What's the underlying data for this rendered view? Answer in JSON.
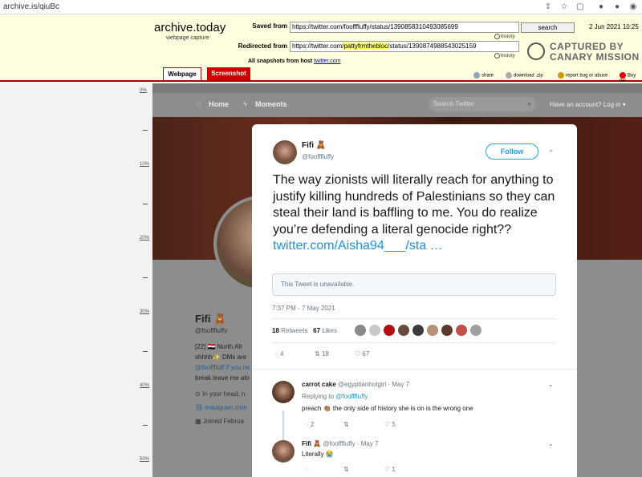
{
  "browser": {
    "url": "archive.is/qiuBc"
  },
  "archive": {
    "title": "archive.today",
    "subtitle": "webpage capture",
    "saved_from_label": "Saved from",
    "saved_from_url": "https://twitter.com/foofffluffy/status/1390858310493085699",
    "redirected_from_label": "Redirected from",
    "redirected_prefix": "https://twitter.com/",
    "redirected_highlight": "pattyfrmthebloc",
    "redirected_suffix": "/status/1390874988543025159",
    "history_label": "history",
    "search_label": "search",
    "date": "2 Jun 2021 10:25",
    "snapshots_label": "All snapshots  from host",
    "snapshots_host": "twitter.com",
    "tab_webpage": "Webpage",
    "tab_screenshot": "Screenshot",
    "link_share": "share",
    "link_download": "download .zip",
    "link_report": "report bug or abuse",
    "link_buy": "Buy me",
    "canary_line1": "CAPTURED BY",
    "canary_line2": "CANARY MISSION"
  },
  "ruler": [
    "0%",
    "10%",
    "20%",
    "30%",
    "40%",
    "50%"
  ],
  "twitter_bg": {
    "nav_home": "Home",
    "nav_moments": "Moments",
    "search_placeholder": "Search Twitter",
    "account_prompt": "Have an account? Log in ▾",
    "profile_name": "Fifi 🧸",
    "profile_handle": "@foofffluffy",
    "bio_line1": "[22] 🇪🇬 North Afr",
    "bio_line2": "shhhh✨ DMs are",
    "bio_line3": "@foofffluff if you ne",
    "bio_line4": "break leave me alo",
    "location": "In your head, n",
    "website": "instagram.com",
    "joined": "Joined Februa"
  },
  "tweet": {
    "name": "Fifi 🧸",
    "handle": "@foofffluffy",
    "follow_label": "Follow",
    "text": "The way zionists will literally reach for anything to justify killing hundreds of Palestinians so they can steal their land is baffling to me. You do realize you’re defending a literal genocide right??",
    "link": "twitter.com/Aisha94___/sta …",
    "unavailable": "This Tweet is unavailable.",
    "timestamp": "7:37 PM - 7 May 2021",
    "retweets_count": "18",
    "retweets_label": "Retweets",
    "likes_count": "67",
    "likes_label": "Likes",
    "reply_count": "4",
    "retweet_action_count": "18",
    "like_action_count": "67",
    "face_colors": [
      "#8a8a8a",
      "#c9c9c9",
      "#b01010",
      "#6a4a3a",
      "#3a3a3a",
      "#b89078",
      "#5a3a2a",
      "#c05050",
      "#a0a0a0"
    ]
  },
  "replies": [
    {
      "name": "carrot cake",
      "handle": "@egyptianhotgirl",
      "date": "· May 7",
      "replying_to_label": "Replying to",
      "replying_to": "@foofffluffy",
      "text": "preach 👏🏽 the only side of history she is on is the wrong one",
      "replies": "2",
      "likes": "5"
    },
    {
      "name": "Fifi 🧸",
      "handle": "@foofffluffy",
      "date": "· May 7",
      "text": "Literally 😭",
      "likes": "1"
    }
  ]
}
